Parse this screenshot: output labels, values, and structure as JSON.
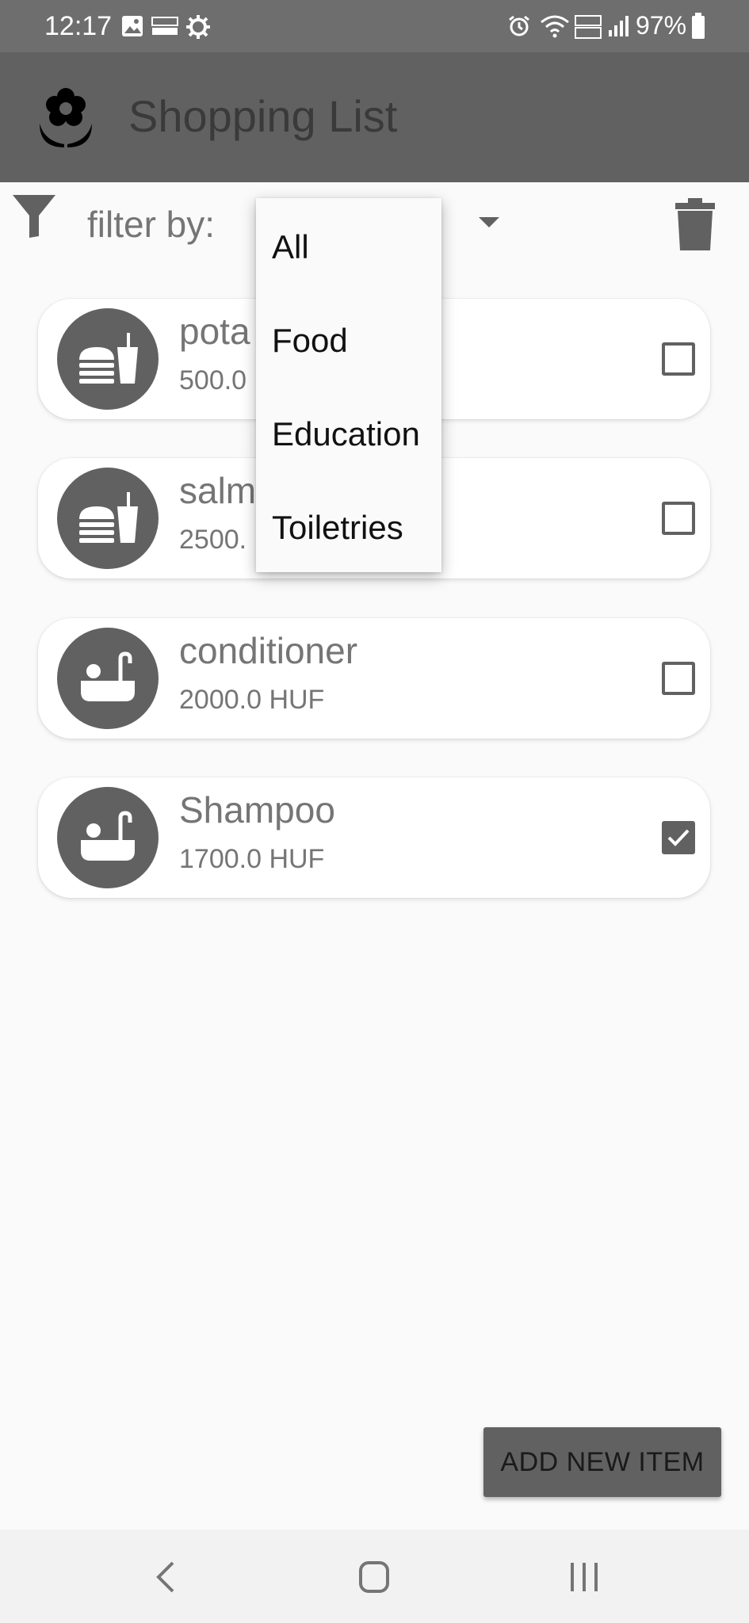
{
  "status_bar": {
    "time": "12:17",
    "battery": "97%",
    "icons": [
      "gallery-icon",
      "temu-icon",
      "settings-gear-icon",
      "alarm-icon",
      "wifi-icon",
      "volte-icon",
      "signal-icon",
      "battery-icon"
    ]
  },
  "app_bar": {
    "title": "Shopping List",
    "logo_icon": "flower-icon"
  },
  "filter": {
    "label": "filter by:",
    "icons": [
      "filter-icon",
      "dropdown-arrow-icon",
      "trash-icon"
    ]
  },
  "filter_menu": {
    "options": [
      "All",
      "Food",
      "Education",
      "Toiletries"
    ]
  },
  "items": [
    {
      "name": "pota",
      "price": "500.0",
      "icon": "food-icon",
      "checked": false
    },
    {
      "name": "salm",
      "price": "2500.",
      "icon": "food-icon",
      "checked": false
    },
    {
      "name": "conditioner",
      "price": "2000.0 HUF",
      "icon": "bathtub-icon",
      "checked": false
    },
    {
      "name": "Shampoo",
      "price": "1700.0 HUF",
      "icon": "bathtub-icon",
      "checked": true
    }
  ],
  "add_button": {
    "label": "ADD NEW ITEM"
  },
  "nav_bar": {
    "buttons": [
      "back-icon",
      "home-icon",
      "recents-icon"
    ]
  },
  "colors": {
    "primary": "#616161",
    "background": "#fafafa",
    "card": "#ffffff"
  }
}
